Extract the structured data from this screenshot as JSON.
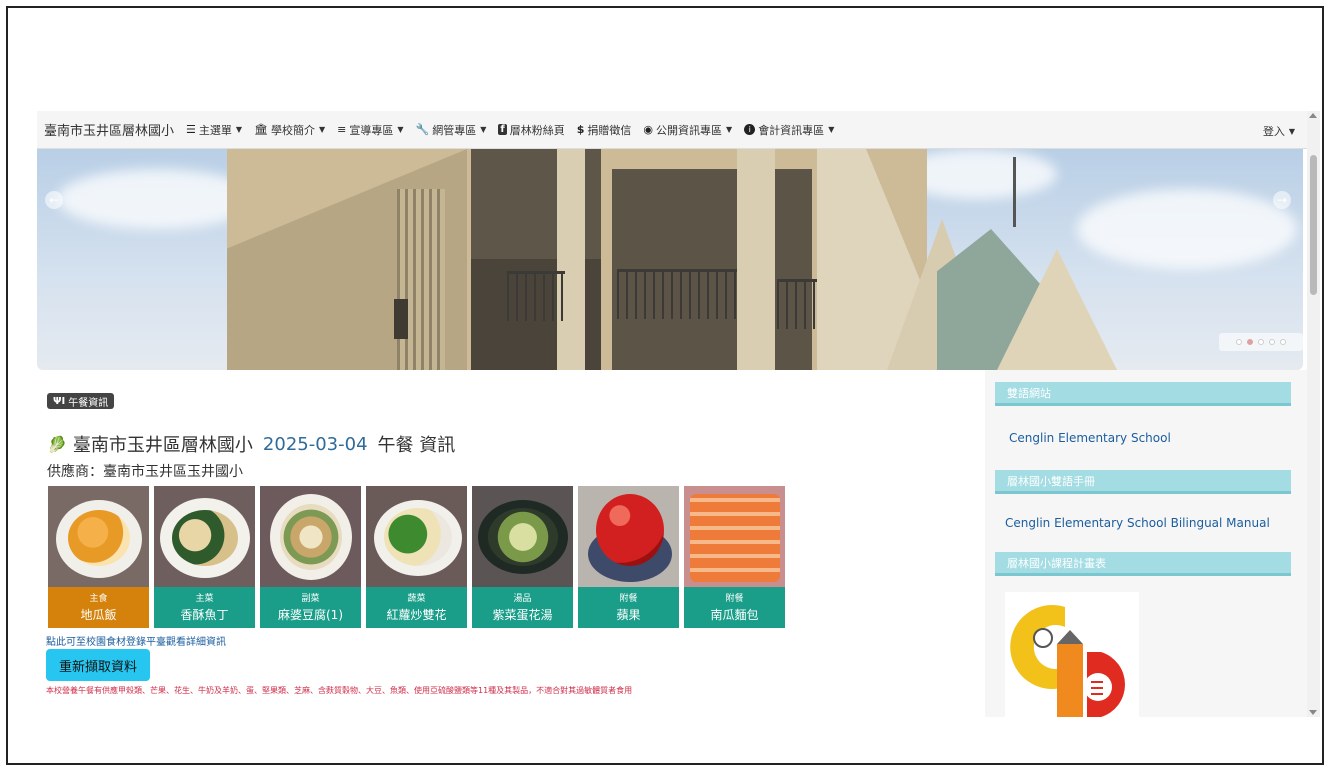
{
  "navbar": {
    "brand": "臺南市玉井區層林國小",
    "items": [
      {
        "icon": "list-icon",
        "glyph": "☰",
        "label": "主選單",
        "caret": true
      },
      {
        "icon": "bank-icon",
        "glyph": "🏛",
        "label": "學校簡介",
        "caret": true
      },
      {
        "icon": "align-left-icon",
        "glyph": "≡",
        "label": "宣導專區",
        "caret": true
      },
      {
        "icon": "wrench-icon",
        "glyph": "🔧",
        "label": "網管專區",
        "caret": true
      },
      {
        "icon": "facebook-icon",
        "glyph": "f",
        "label": "層林粉絲頁",
        "caret": false
      },
      {
        "icon": "dollar-icon",
        "glyph": "$",
        "label": "捐贈徵信",
        "caret": false
      },
      {
        "icon": "eye-icon",
        "glyph": "◉",
        "label": "公開資訊專區",
        "caret": true
      },
      {
        "icon": "info-icon",
        "glyph": "ℹ",
        "label": "會計資訊專區",
        "caret": true
      }
    ],
    "login": "登入"
  },
  "carousel": {
    "prev_glyph": "←",
    "next_glyph": "→",
    "slide_count": 5,
    "active_index": 1
  },
  "lunch": {
    "badge": "午餐資訊",
    "school": "臺南市玉井區層林國小",
    "date": "2025-03-04",
    "suffix": "午餐 資訊",
    "supplier": "供應商：臺南市玉井區玉井國小",
    "dishes": [
      {
        "category": "主食",
        "name": "地瓜飯"
      },
      {
        "category": "主菜",
        "name": "香酥魚丁"
      },
      {
        "category": "副菜",
        "name": "麻婆豆腐(1)"
      },
      {
        "category": "蔬菜",
        "name": "紅蘿炒雙花"
      },
      {
        "category": "湯品",
        "name": "紫菜蛋花湯"
      },
      {
        "category": "附餐",
        "name": "蘋果"
      },
      {
        "category": "附餐",
        "name": "南瓜麵包"
      }
    ],
    "registry_link": "點此可至校園食材登錄平臺觀看詳細資訊",
    "refresh_button": "重新擷取資料",
    "allergy_notice": "本校營養午餐有供應甲殼類、芒果、花生、牛奶及羊奶、蛋、堅果類、芝麻、含麩質穀物、大豆、魚類、使用亞硫酸鹽類等11種及其製品，不適合對其過敏體質者食用"
  },
  "sidebar": {
    "bilingual_head": "雙語網站",
    "bilingual_link": "Cenglin Elementary School",
    "manual_head": "層林國小雙語手冊",
    "manual_link": "Cenglin Elementary School Bilingual Manual",
    "curriculum_head": "層林國小課程計畫表"
  },
  "colors": {
    "main_dish_label": "#d4820b",
    "dish_label": "#1a9e8a",
    "sidebar_head": "#a3dde3",
    "refresh_button": "#26c6f0",
    "allergy_text": "#d0304b",
    "date_text": "#2f6b9a"
  }
}
